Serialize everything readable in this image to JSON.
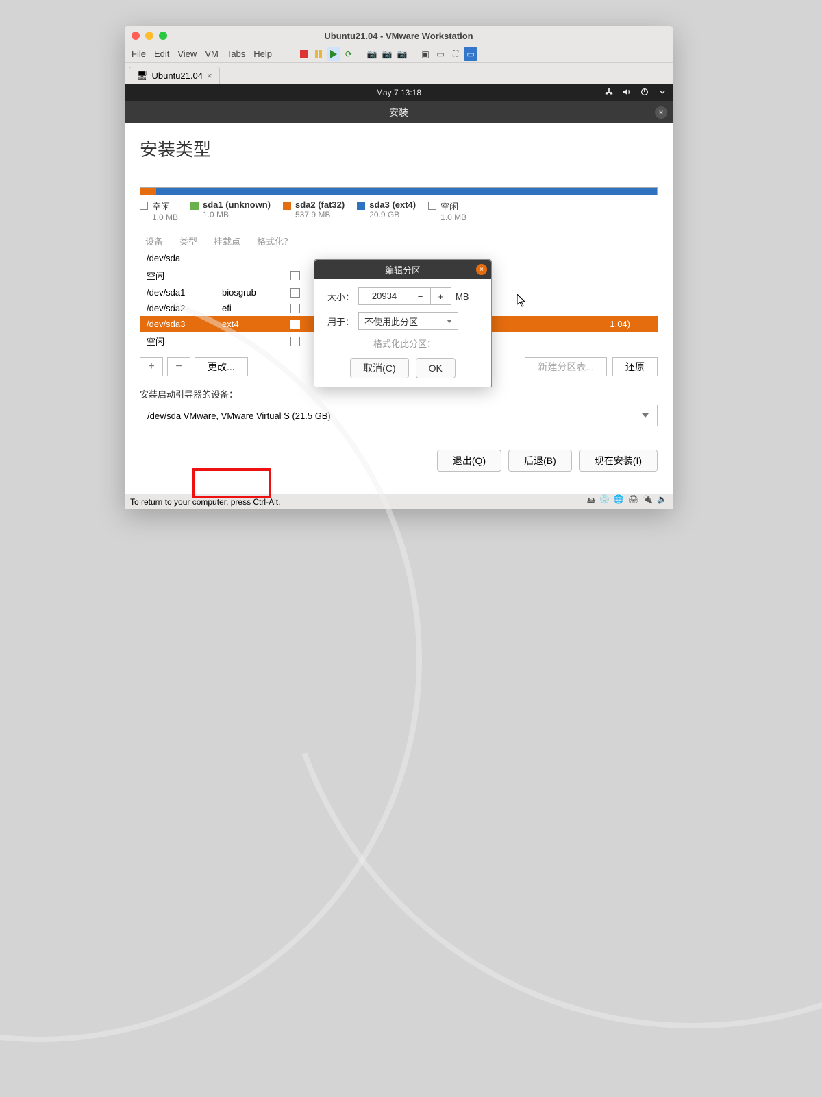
{
  "window": {
    "title": "Ubuntu21.04 - VMware Workstation"
  },
  "menu": {
    "file": "File",
    "edit": "Edit",
    "view": "View",
    "vm": "VM",
    "tabs": "Tabs",
    "help": "Help"
  },
  "tab": {
    "label": "Ubuntu21.04"
  },
  "gnome": {
    "datetime": "May 7  13:18"
  },
  "installer": {
    "header": "安装",
    "title": "安装类型",
    "legend": [
      {
        "label": "空闲",
        "sub": "1.0 MB"
      },
      {
        "label": "sda1 (unknown)",
        "sub": "1.0 MB"
      },
      {
        "label": "sda2 (fat32)",
        "sub": "537.9 MB"
      },
      {
        "label": "sda3 (ext4)",
        "sub": "20.9 GB"
      },
      {
        "label": "空闲",
        "sub": "1.0 MB"
      }
    ],
    "columns": {
      "device": "设备",
      "type": "类型",
      "mount": "挂载点",
      "format": "格式化？"
    },
    "rows": [
      {
        "dev": "/dev/sda",
        "type": ""
      },
      {
        "dev": "空闲",
        "type": "",
        "checkbox": true
      },
      {
        "dev": "/dev/sda1",
        "type": "biosgrub",
        "checkbox": true
      },
      {
        "dev": "/dev/sda2",
        "type": "efi",
        "checkbox": true
      },
      {
        "dev": "/dev/sda3",
        "type": "ext4",
        "checkbox": true,
        "selected": true,
        "extra": "1.04)"
      },
      {
        "dev": "空闲",
        "type": "",
        "checkbox": true
      }
    ],
    "buttons": {
      "change": "更改...",
      "newtable": "新建分区表...",
      "revert": "还原"
    },
    "boot_label": "安装启动引导器的设备：",
    "boot_value": "/dev/sda   VMware, VMware Virtual S (21.5 GB)",
    "wizard": {
      "quit": "退出(Q)",
      "back": "后退(B)",
      "install": "现在安装(I)"
    }
  },
  "dialog": {
    "title": "编辑分区",
    "size_label": "大小：",
    "size_value": "20934",
    "size_unit": "MB",
    "use_label": "用于：",
    "use_value": "不使用此分区",
    "format_label": "格式化此分区：",
    "cancel": "取消(C)",
    "ok": "OK"
  },
  "statusbar": {
    "hint": "To return to your computer, press Ctrl-Alt."
  }
}
